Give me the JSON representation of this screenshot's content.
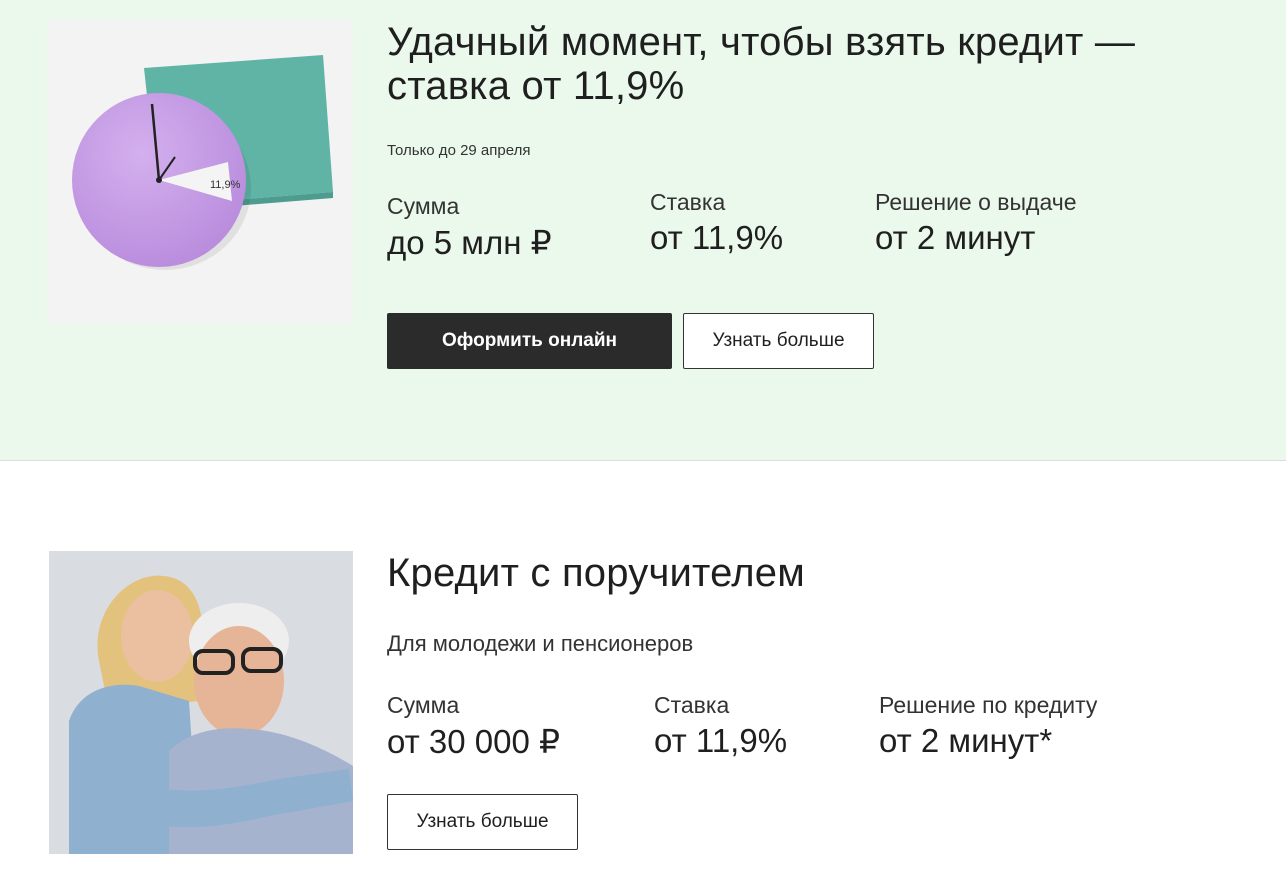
{
  "promo1": {
    "title_line1": "Удачный момент, чтобы взять кредит —",
    "title_line2": "ставка от 11,9%",
    "subtitle": "Только до 29 апреля",
    "clock_label": "11,9%",
    "stats": [
      {
        "label": "Сумма",
        "value": "до 5 млн ₽"
      },
      {
        "label": "Ставка",
        "value": "от 11,9%"
      },
      {
        "label": "Решение о выдаче",
        "value": "от 2 минут"
      }
    ],
    "primary_button": "Оформить онлайн",
    "secondary_button": "Узнать больше",
    "colors": {
      "background": "#ebf8ec",
      "clock": "#c79ee4",
      "square": "#5fb4a6",
      "button_dark": "#2b2b2b"
    }
  },
  "promo2": {
    "title": "Кредит с поручителем",
    "subtitle": "Для молодежи и пенсионеров",
    "stats": [
      {
        "label": "Сумма",
        "value": "от 30 000 ₽"
      },
      {
        "label": "Ставка",
        "value": "от 11,9%"
      },
      {
        "label": "Решение по кредиту",
        "value": "от 2 минут*"
      }
    ],
    "secondary_button": "Узнать больше"
  }
}
